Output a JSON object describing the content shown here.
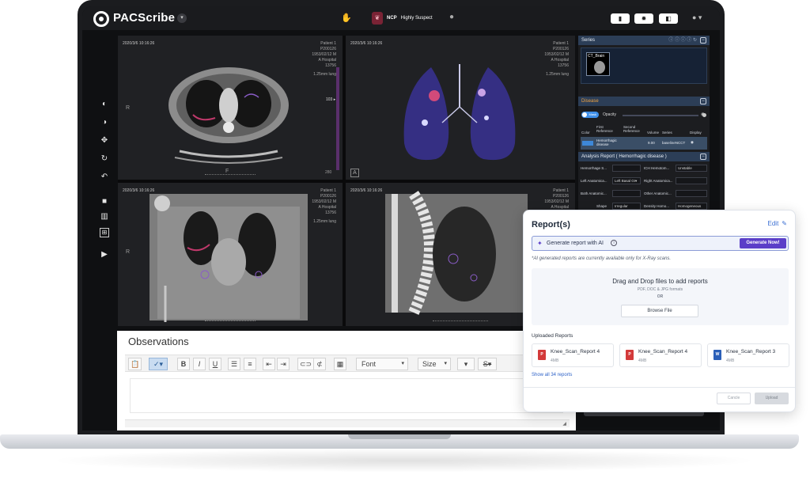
{
  "app": {
    "logo": "PACScribe",
    "badge": "NCP",
    "badge_text": "Highly Suspect"
  },
  "viewports": [
    {
      "date": "2020/3/6 10:16:26",
      "info": [
        "Patient 1",
        "P200126",
        "1953/02/12 M",
        "A Hospital",
        "13756",
        "1.25mm lung"
      ],
      "side_label": "R",
      "bottom_label": "F",
      "side_value": "103 ▸",
      "corner_value": "280"
    },
    {
      "date": "2020/3/6 10:16:26",
      "info": [
        "Patient 1",
        "P200126",
        "1953/02/12 M",
        "A Hospital",
        "13756",
        "1.25mm lung"
      ],
      "corner_tag": "A"
    },
    {
      "date": "2020/3/6 10:16:26",
      "info": [
        "Patient 1",
        "P200126",
        "1953/02/12 M",
        "A Hospital",
        "13756",
        "1.25mm lung"
      ],
      "side_label": "R"
    },
    {
      "date": "2020/3/6 10:16:26",
      "info": [
        "Patient 1",
        "P200126",
        "1953/02/12 M",
        "A Hospital",
        "13756"
      ]
    }
  ],
  "panel": {
    "series_title": "Series",
    "series_thumb": "CT_Brain",
    "disease_title": "Disease",
    "mask_label": "Mask",
    "opacity_label": "Opacity",
    "table_headers": [
      "Color",
      "First Reference",
      "Second Reference",
      "Volume",
      "Series",
      "Display"
    ],
    "row": {
      "name": "Hemorrhagic disease",
      "volume": "9.00",
      "series": "baselineNCCT",
      "color": "#3e88d8"
    },
    "analysis_title": "Analysis Report ( Hemorrhagic disease )",
    "fields": [
      {
        "l1": "Hemorrhage S...",
        "v1": "",
        "l2": "ICH Hemotom...",
        "v2": "Unstable"
      },
      {
        "l1": "Left Anatomica...",
        "v1": "Left Basal GI▾",
        "l2": "Right Anatomica...",
        "v2": ""
      },
      {
        "l1": "Both Anatomic...",
        "v1": "",
        "l2": "Other Anatomic...",
        "v2": ""
      },
      {
        "l1": "Shape",
        "v1": "Irregular",
        "l2": "Density Homo...",
        "v2": "Homogeneous"
      }
    ]
  },
  "observations": {
    "title": "Observations",
    "font_label": "Font",
    "size_label": "Size"
  },
  "reports": {
    "title": "Report(s)",
    "edit_label": "Edit",
    "ai_label": "Generate report with AI",
    "ai_button": "Generate Now!",
    "ai_note": "*AI generated reports are currently available only for X-Ray scans.",
    "drop_title": "Drag and Drop files to add reports",
    "drop_formats": "PDF, DOC & JPG formats",
    "drop_or": "OR",
    "browse_label": "Browse File",
    "uploaded_title": "Uploaded Reports",
    "files": [
      {
        "name": "Knee_Scan_Report 4",
        "size": "4MB",
        "type": "pdf"
      },
      {
        "name": "Knee_Scan_Report 4",
        "size": "4MB",
        "type": "pdf"
      },
      {
        "name": "Knee_Scan_Report 3",
        "size": "4MB",
        "type": "doc"
      }
    ],
    "show_all": "Show all 34 reports",
    "cancel_label": "Cancle",
    "upload_label": "Upload"
  },
  "colors": {
    "accent_purple": "#5b3ec8",
    "link_blue": "#2f63c8",
    "panel_header": "#2c3e57",
    "disease_orange": "#f0a341"
  }
}
